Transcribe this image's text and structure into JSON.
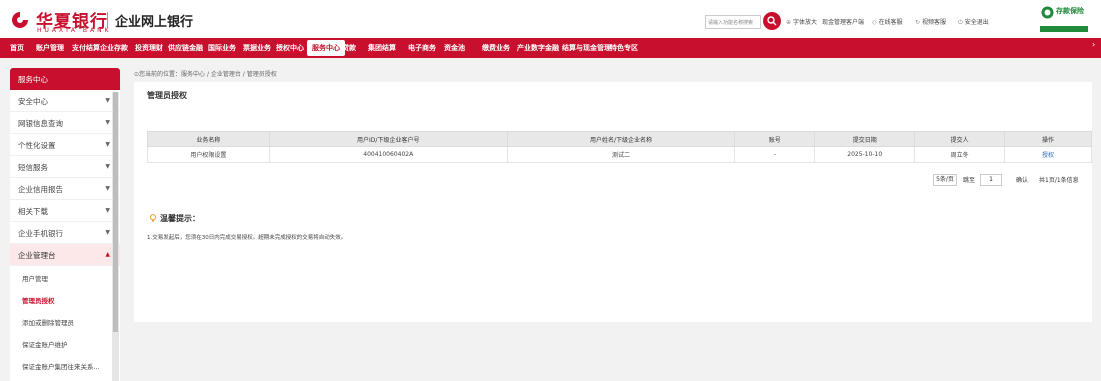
{
  "brand": {
    "name_cn": "华夏银行",
    "name_en": "HUAXIA BANK",
    "subtitle": "企业网上银行",
    "corner_badge": "存款保险",
    "brand_color": "#c8102e"
  },
  "header": {
    "search_placeholder": "请输入功能名称搜索",
    "utilities": [
      {
        "icon": "font-size-icon",
        "label": "字体放大"
      },
      {
        "label": "现金管理客户端"
      },
      {
        "icon": "online-service-icon",
        "label": "在线客服"
      },
      {
        "icon": "video-service-icon",
        "label": "视频客服"
      },
      {
        "icon": "power-icon",
        "label": "安全退出"
      }
    ]
  },
  "nav": {
    "items": [
      "首页",
      "账户管理",
      "支付结算",
      "企业存款",
      "投资理财",
      "供应链金融",
      "国际业务",
      "票据业务",
      "授权中心",
      "服务中心",
      "贷款",
      "集团结算",
      "电子商务",
      "资金池",
      "缴费业务",
      "产业数字金融",
      "结算与现金管理",
      "特色专区"
    ],
    "active_index": 9
  },
  "sidebar": {
    "header": "服务中心",
    "items": [
      "安全中心",
      "网银信息查询",
      "个性化设置",
      "短信服务",
      "企业信用报告",
      "相关下载",
      "企业手机银行"
    ],
    "open_group": "企业管理台",
    "sub_items": [
      "用户管理",
      "管理员授权",
      "添加或删除管理员",
      "保证金账户维护",
      "保证金账户集团往来关系..."
    ],
    "active_sub_index": 1
  },
  "breadcrumb": "您当前的位置：服务中心 / 企业管理台 / 管理员授权",
  "page_title": "管理员授权",
  "table": {
    "headers": [
      "业务名称",
      "用户ID/下级企业客户号",
      "用户姓名/下级企业名称",
      "账号",
      "提交日期",
      "提交人",
      "操作"
    ],
    "rows": [
      [
        "用户权限设置",
        "400410060402A",
        "测试二",
        "-",
        "2025-10-10",
        "周立冬",
        "授权"
      ]
    ]
  },
  "pager": {
    "page_size": "5条/页",
    "goto_label": "跳至",
    "goto_value": "1",
    "confirm": "确认",
    "summary": "共1页/1条信息"
  },
  "tips": {
    "title": "温馨提示：",
    "text": "1.交易发起后，您须在30日内完成交易授权。超期未完成授权的交易将自动失效。"
  }
}
